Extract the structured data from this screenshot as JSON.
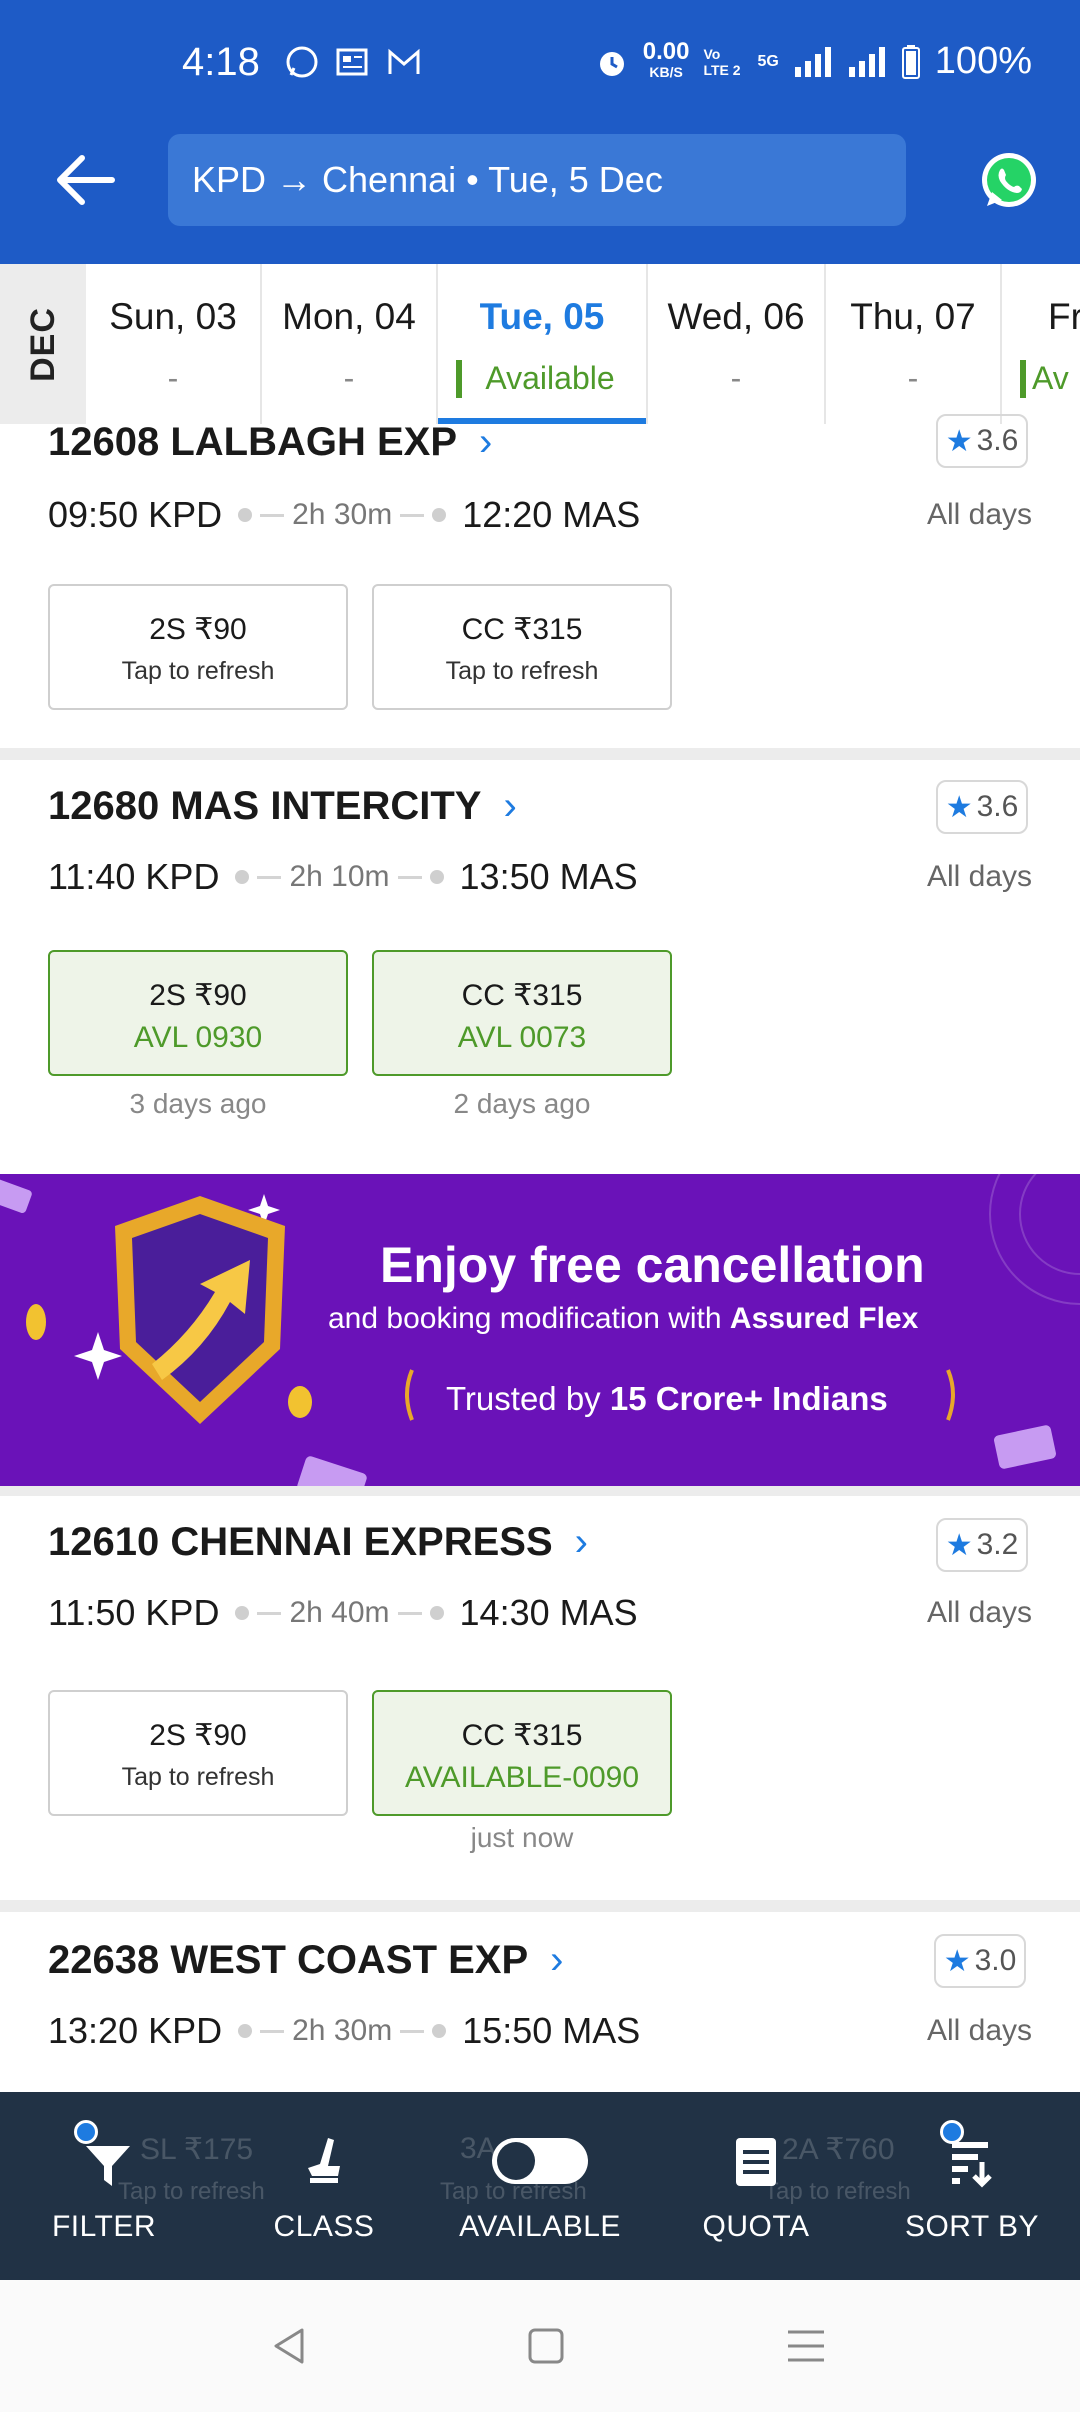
{
  "status_bar": {
    "time": "4:18",
    "net_speed_value": "0.00",
    "net_speed_unit": "KB/S",
    "volte": "Vo LTE 2",
    "net_type": "5G",
    "battery": "100%"
  },
  "header": {
    "route": "KPD → Chennai • Tue, 5 Dec"
  },
  "date_strip": {
    "month": "DEC",
    "dates": [
      {
        "label": "Sun, 03",
        "sub": "-"
      },
      {
        "label": "Mon, 04",
        "sub": "-"
      },
      {
        "label": "Tue, 05",
        "sub": "Available"
      },
      {
        "label": "Wed, 06",
        "sub": "-"
      },
      {
        "label": "Thu, 07",
        "sub": "-"
      },
      {
        "label": "Fr",
        "sub": "Av"
      }
    ]
  },
  "trains": [
    {
      "name": "12608  LALBAGH EXP",
      "rating": "3.6",
      "dep": "09:50 KPD",
      "duration": "2h 30m",
      "arr": "12:20 MAS",
      "days": "All days",
      "classes": [
        {
          "cls": "2S  ₹90",
          "status": "Tap to refresh"
        },
        {
          "cls": "CC  ₹315",
          "status": "Tap to refresh"
        }
      ]
    },
    {
      "name": "12680  MAS INTERCITY",
      "rating": "3.6",
      "dep": "11:40 KPD",
      "duration": "2h 10m",
      "arr": "13:50 MAS",
      "days": "All days",
      "classes": [
        {
          "cls": "2S  ₹90",
          "status": "AVL 0930",
          "ago": "3 days ago"
        },
        {
          "cls": "CC  ₹315",
          "status": "AVL 0073",
          "ago": "2 days ago"
        }
      ]
    },
    {
      "name": "12610  CHENNAI EXPRESS",
      "rating": "3.2",
      "dep": "11:50 KPD",
      "duration": "2h 40m",
      "arr": "14:30 MAS",
      "days": "All days",
      "classes": [
        {
          "cls": "2S  ₹90",
          "status": "Tap to refresh"
        },
        {
          "cls": "CC  ₹315",
          "status": "AVAILABLE-0090",
          "ago": "just now"
        }
      ]
    },
    {
      "name": "22638  WEST COAST EXP",
      "rating": "3.0",
      "dep": "13:20 KPD",
      "duration": "2h 30m",
      "arr": "15:50 MAS",
      "days": "All days",
      "ghost_classes": [
        {
          "cls": "SL  ₹175",
          "status": "Tap to refresh"
        },
        {
          "cls": "3A",
          "status": "Tap to refresh"
        },
        {
          "cls": "2A  ₹760",
          "status": "Tap to refresh"
        }
      ]
    }
  ],
  "banner": {
    "title": "Enjoy free cancellation",
    "subtitle_prefix": "and booking modification with ",
    "subtitle_bold": "Assured Flex",
    "trust_prefix": "Trusted by ",
    "trust_bold": "15 Crore+ Indians"
  },
  "bottom_bar": {
    "filter": "FILTER",
    "class": "CLASS",
    "available": "AVAILABLE",
    "quota": "QUOTA",
    "sort": "SORT BY"
  },
  "colors": {
    "brand_blue": "#1e5bc6",
    "accent_blue": "#1e7be0",
    "available_green": "#4e9a2a",
    "banner_purple": "#6a12b8",
    "bottom_bar": "#213245"
  }
}
